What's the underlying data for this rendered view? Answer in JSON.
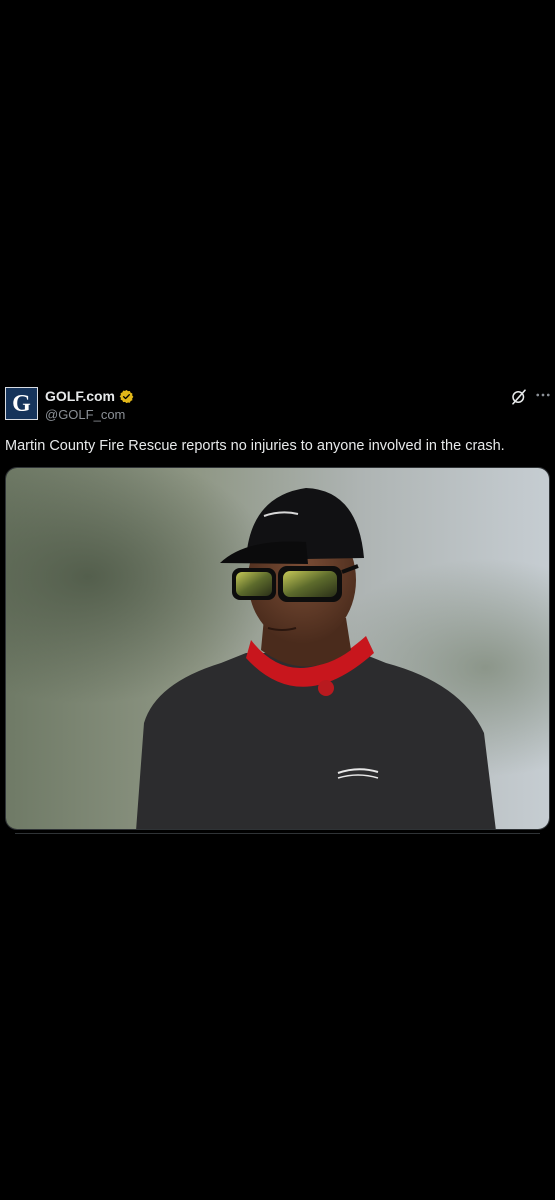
{
  "post": {
    "author": {
      "display_name": "GOLF.com",
      "handle": "@GOLF_com",
      "avatar_letter": "G",
      "verified": true,
      "verified_color": "#e2b719"
    },
    "text": "Martin County Fire Rescue reports no injuries to anyone involved in the crash.",
    "media": {
      "kind": "photo"
    },
    "actions": {
      "grok_icon": "grok-icon",
      "more_icon": "more-options-icon"
    }
  },
  "colors": {
    "background": "#000000",
    "text": "#e7e9ea",
    "secondary_text": "#8b9096",
    "avatar_bg": "#16345b"
  }
}
